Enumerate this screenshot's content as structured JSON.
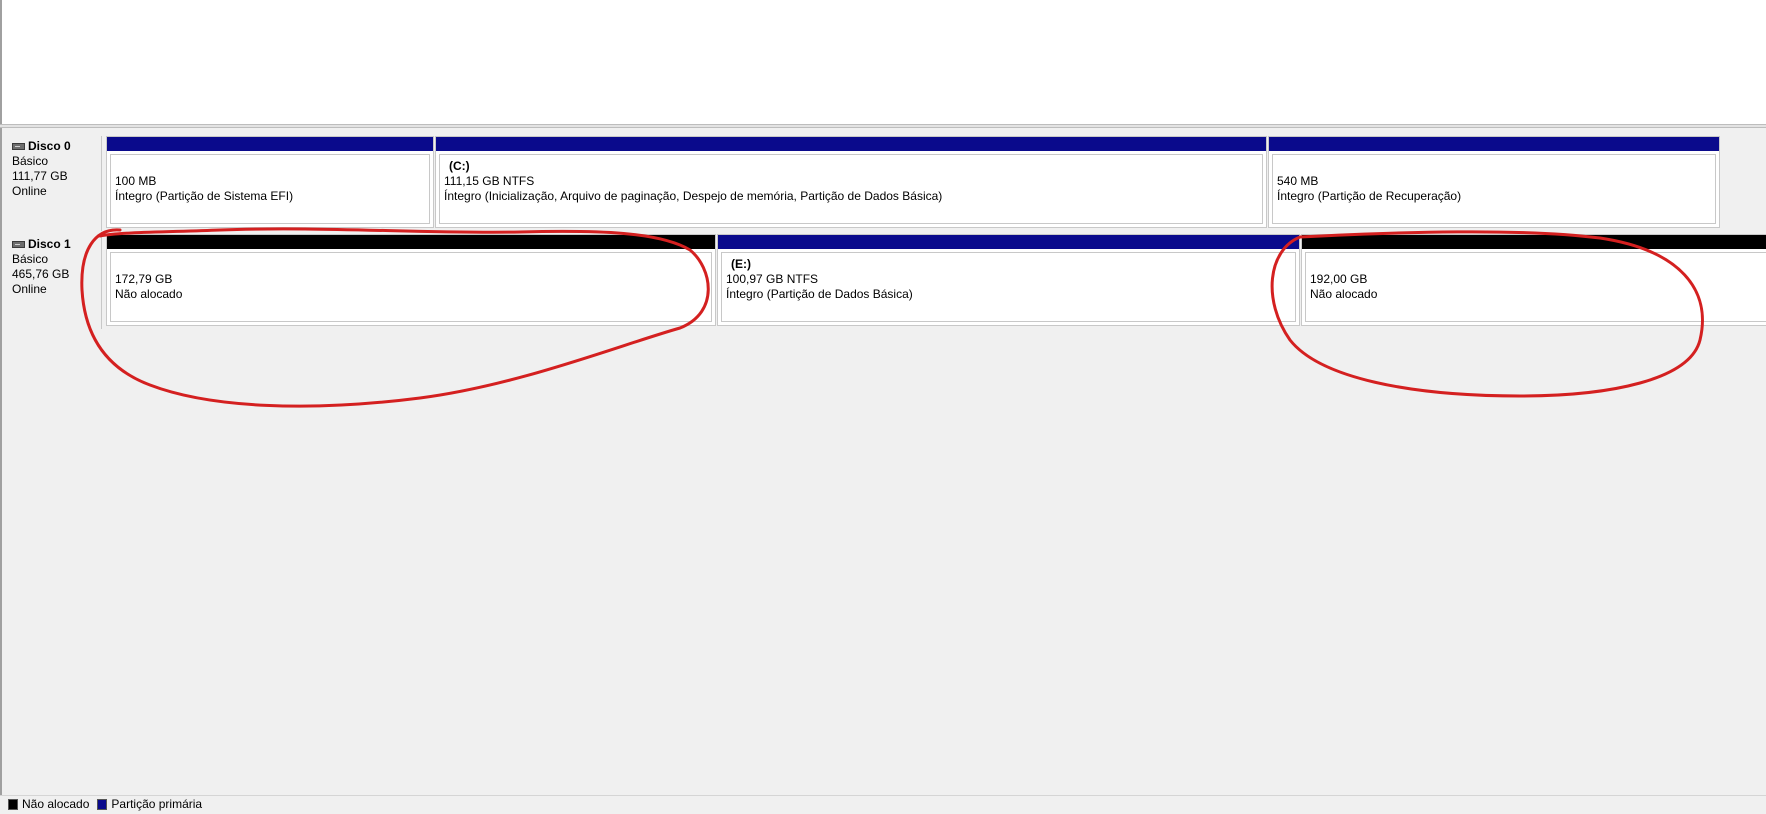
{
  "colors": {
    "primary_partition": "#0a0a8c",
    "unallocated": "#000000",
    "annotation": "#d42020"
  },
  "disks": [
    {
      "name": "Disco 0",
      "type": "Básico",
      "size": "111,77 GB",
      "status": "Online",
      "partitions": [
        {
          "kind": "primary",
          "label": "",
          "size": "100 MB",
          "status": "Íntegro (Partição de Sistema EFI)"
        },
        {
          "kind": "primary",
          "label": "(C:)",
          "size": "111,15 GB NTFS",
          "status": "Íntegro (Inicialização, Arquivo de paginação, Despejo de memória, Partição de Dados Básica)"
        },
        {
          "kind": "primary",
          "label": "",
          "size": "540 MB",
          "status": "Íntegro (Partição de Recuperação)"
        }
      ]
    },
    {
      "name": "Disco 1",
      "type": "Básico",
      "size": "465,76 GB",
      "status": "Online",
      "partitions": [
        {
          "kind": "unalloc",
          "label": "",
          "size": "172,79 GB",
          "status": "Não alocado"
        },
        {
          "kind": "primary",
          "label": "(E:)",
          "size": "100,97 GB NTFS",
          "status": "Íntegro (Partição de Dados Básica)"
        },
        {
          "kind": "unalloc",
          "label": "",
          "size": "192,00 GB",
          "status": "Não alocado"
        }
      ]
    }
  ],
  "legend": [
    {
      "kind": "unalloc",
      "label": "Não alocado"
    },
    {
      "kind": "primary",
      "label": "Partição primária"
    }
  ]
}
